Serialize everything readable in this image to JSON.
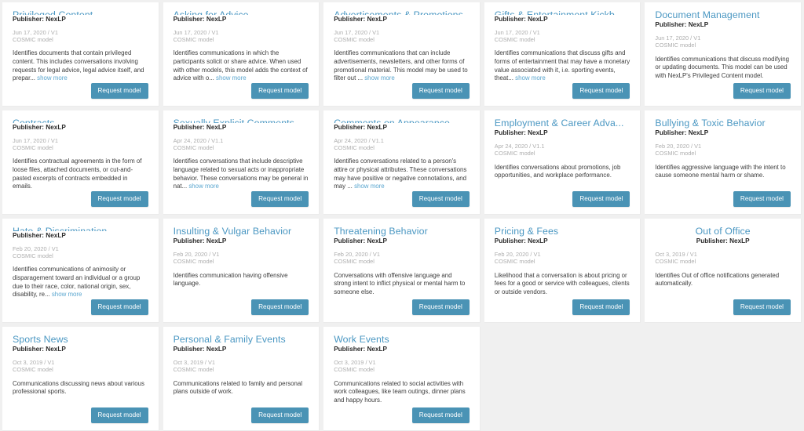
{
  "theme": {
    "page_background": "#f0f0f0",
    "card_background": "#ffffff",
    "title_color": "#4a97c2",
    "link_color": "#5aa6cf",
    "button_color": "#4a93b5",
    "meta_color": "#adadad"
  },
  "common": {
    "request_label": "Request model",
    "show_more_label": "show more",
    "model_type": "COSMIC model"
  },
  "cards": [
    {
      "title": "Privileged Content",
      "publisher": "Publisher: NexLP",
      "date_version": "Jun 17, 2020 / V1",
      "model_type": "COSMIC model",
      "description": "Identifies documents that contain privileged content. This includes conversations involving requests for legal advice, legal advice itself, and prepar...",
      "show_more": "show more",
      "request_label": "Request model",
      "align": "left"
    },
    {
      "title": "Asking for Advice",
      "publisher": "Publisher: NexLP",
      "date_version": "Jun 17, 2020 / V1",
      "model_type": "COSMIC model",
      "description": "Identifies communications in which the participants solicit or share advice. When used with other models, this model adds the context of advice with o...",
      "show_more": "show more",
      "request_label": "Request model",
      "align": "left"
    },
    {
      "title": "Advertisements & Promotions",
      "publisher": "Publisher: NexLP",
      "date_version": "Jun 17, 2020 / V1",
      "model_type": "COSMIC model",
      "description": "Identifies communications that can include advertisements, newsletters, and other forms of promotional material. This model may be used to filter out ...",
      "show_more": "show more",
      "request_label": "Request model",
      "align": "left"
    },
    {
      "title": "Gifts & Entertainment Kickb...",
      "publisher": "Publisher: NexLP",
      "date_version": "Jun 17, 2020 / V1",
      "model_type": "COSMIC model",
      "description": "Identifies communications that discuss gifts and forms of entertainment that may have a monetary value associated with it, i.e. sporting events, theat...",
      "show_more": "show more",
      "request_label": "Request model",
      "align": "left"
    },
    {
      "title": "Document Management",
      "publisher": "Publisher: NexLP",
      "date_version": "Jun 17, 2020 / V1",
      "model_type": "COSMIC model",
      "description": "Identifies communications that discuss modifying or updating documents. This model can be used with NexLP's Privileged Content model.",
      "show_more": "",
      "request_label": "Request model",
      "align": "left"
    },
    {
      "title": "Contracts",
      "publisher": "Publisher: NexLP",
      "date_version": "Jun 17, 2020 / V1",
      "model_type": "COSMIC model",
      "description": "Identifies contractual agreements in the form of loose files, attached documents, or cut-and-pasted excerpts of contracts embedded in emails.",
      "show_more": "",
      "request_label": "Request model",
      "align": "left"
    },
    {
      "title": "Sexually Explicit Comments",
      "publisher": "Publisher: NexLP",
      "date_version": "Apr 24, 2020 / V1.1",
      "model_type": "COSMIC model",
      "description": "Identifies conversations that include descriptive language related to sexual acts or inappropriate behavior. These conversations may be general in nat...",
      "show_more": "show more",
      "request_label": "Request model",
      "align": "left"
    },
    {
      "title": "Comments on Appearance",
      "publisher": "Publisher: NexLP",
      "date_version": "Apr 24, 2020 / V1.1",
      "model_type": "COSMIC model",
      "description": "Identifies conversations related to a person's attire or physical attributes. These conversations may have positive or negative connotations, and may ...",
      "show_more": "show more",
      "request_label": "Request model",
      "align": "left"
    },
    {
      "title": "Employment & Career Adva...",
      "publisher": "Publisher: NexLP",
      "date_version": "Apr 24, 2020 / V1.1",
      "model_type": "COSMIC model",
      "description": "Identifies conversations about promotions, job opportunities, and workplace performance.",
      "show_more": "",
      "request_label": "Request model",
      "align": "left"
    },
    {
      "title": "Bullying & Toxic Behavior",
      "publisher": "Publisher: NexLP",
      "date_version": "Feb 20, 2020 / V1",
      "model_type": "COSMIC model",
      "description": "Identifies aggressive language with the intent to cause someone mental harm or shame.",
      "show_more": "",
      "request_label": "Request model",
      "align": "left"
    },
    {
      "title": "Hate & Discrimination",
      "publisher": "Publisher: NexLP",
      "date_version": "Feb 20, 2020 / V1",
      "model_type": "COSMIC model",
      "description": "Identifies communications of animosity or disparagement toward an individual or a group due to their race, color, national origin, sex, disability, re...",
      "show_more": "show more",
      "request_label": "Request model",
      "align": "left"
    },
    {
      "title": "Insulting & Vulgar Behavior",
      "publisher": "Publisher: NexLP",
      "date_version": "Feb 20, 2020 / V1",
      "model_type": "COSMIC model",
      "description": "Identifies communication having offensive language.",
      "show_more": "",
      "request_label": "Request model",
      "align": "left"
    },
    {
      "title": "Threatening Behavior",
      "publisher": "Publisher: NexLP",
      "date_version": "Feb 20, 2020 / V1",
      "model_type": "COSMIC model",
      "description": "Conversations with offensive language and strong intent to inflict physical or mental harm to someone else.",
      "show_more": "",
      "request_label": "Request model",
      "align": "left"
    },
    {
      "title": "Pricing & Fees",
      "publisher": "Publisher: NexLP",
      "date_version": "Feb 20, 2020 / V1",
      "model_type": "COSMIC model",
      "description": "Likelihood that a conversation is about pricing or fees for a good or service with colleagues, clients or outside vendors.",
      "show_more": "",
      "request_label": "Request model",
      "align": "left"
    },
    {
      "title": "Out of Office",
      "publisher": "Publisher: NexLP",
      "date_version": "Oct 3, 2019 / V1",
      "model_type": "COSMIC model",
      "description": "Identifies Out of office notifications generated automatically.",
      "show_more": "",
      "request_label": "Request model",
      "align": "center"
    },
    {
      "title": "Sports News",
      "publisher": "Publisher: NexLP",
      "date_version": "Oct 3, 2019 / V1",
      "model_type": "COSMIC model",
      "description": "Communications discussing news about various professional sports.",
      "show_more": "",
      "request_label": "Request model",
      "align": "left"
    },
    {
      "title": "Personal & Family Events",
      "publisher": "Publisher: NexLP",
      "date_version": "Oct 3, 2019 / V1",
      "model_type": "COSMIC model",
      "description": "Communications related to family and personal plans outside of work.",
      "show_more": "",
      "request_label": "Request model",
      "align": "left"
    },
    {
      "title": "Work Events",
      "publisher": "Publisher: NexLP",
      "date_version": "Oct 3, 2019 / V1",
      "model_type": "COSMIC model",
      "description": "Communications related to social activities with work colleagues, like team outings, dinner plans and happy hours.",
      "show_more": "",
      "request_label": "Request model",
      "align": "left"
    }
  ]
}
